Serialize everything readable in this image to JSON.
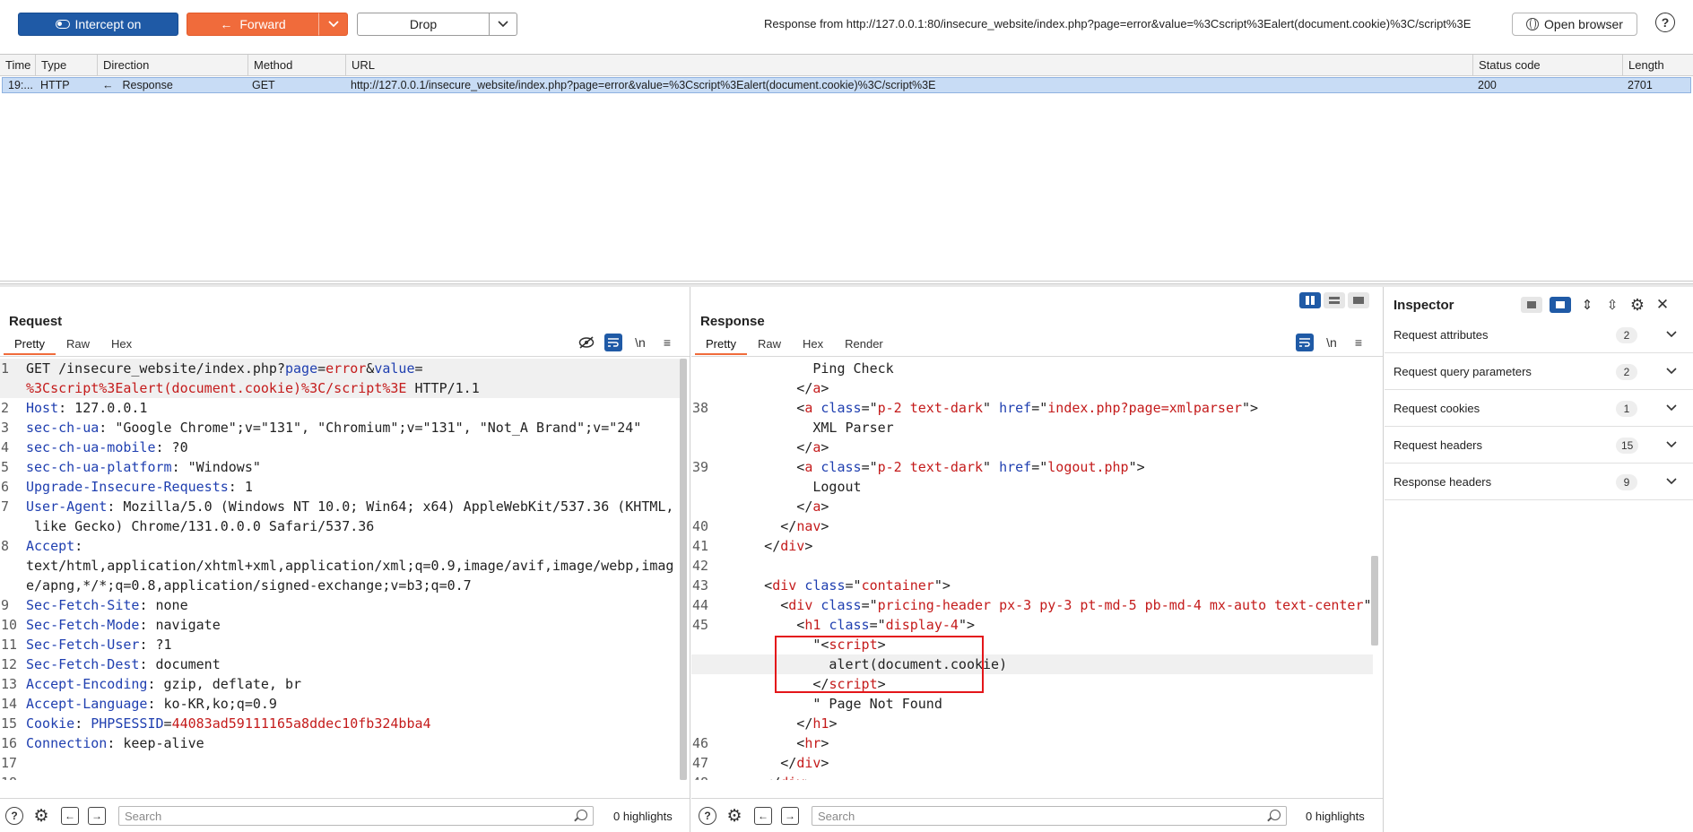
{
  "toolbar": {
    "intercept_label": "Intercept on",
    "forward_label": "Forward",
    "drop_label": "Drop",
    "status_text": "Response from http://127.0.0.1:80/insecure_website/index.php?page=error&value=%3Cscript%3Ealert(document.cookie)%3C/script%3E",
    "open_browser_label": "Open browser",
    "help_glyph": "?"
  },
  "history": {
    "columns": [
      "Time",
      "Type",
      "Direction",
      "Method",
      "URL",
      "Status code",
      "Length"
    ],
    "rows": [
      {
        "time": "19:...",
        "type": "HTTP",
        "direction": "Response",
        "method": "GET",
        "url": "http://127.0.0.1/insecure_website/index.php?page=error&value=%3Cscript%3Ealert(document.cookie)%3C/script%3E",
        "status": "200",
        "length": "2701"
      }
    ]
  },
  "request": {
    "title": "Request",
    "tabs": [
      "Pretty",
      "Raw",
      "Hex"
    ],
    "active_tab": "Pretty",
    "search_placeholder": "Search",
    "highlights": "0 highlights"
  },
  "response": {
    "title": "Response",
    "tabs": [
      "Pretty",
      "Raw",
      "Hex",
      "Render"
    ],
    "active_tab": "Pretty",
    "search_placeholder": "Search",
    "highlights": "0 highlights"
  },
  "inspector": {
    "title": "Inspector",
    "sections": [
      {
        "label": "Request attributes",
        "count": "2"
      },
      {
        "label": "Request query parameters",
        "count": "2"
      },
      {
        "label": "Request cookies",
        "count": "1"
      },
      {
        "label": "Request headers",
        "count": "15"
      },
      {
        "label": "Response headers",
        "count": "9"
      }
    ]
  },
  "icons": {
    "wrap": "\\n",
    "menu": "≡",
    "prev": "←",
    "next": "→",
    "settings": "⚙",
    "chevron": "⌄",
    "close": "✕"
  },
  "colors": {
    "accent_blue": "#1f5aa6",
    "forward_orange": "#f06b3b",
    "selected_row": "#c8dcf5",
    "highlight_red": "#e4161a"
  }
}
